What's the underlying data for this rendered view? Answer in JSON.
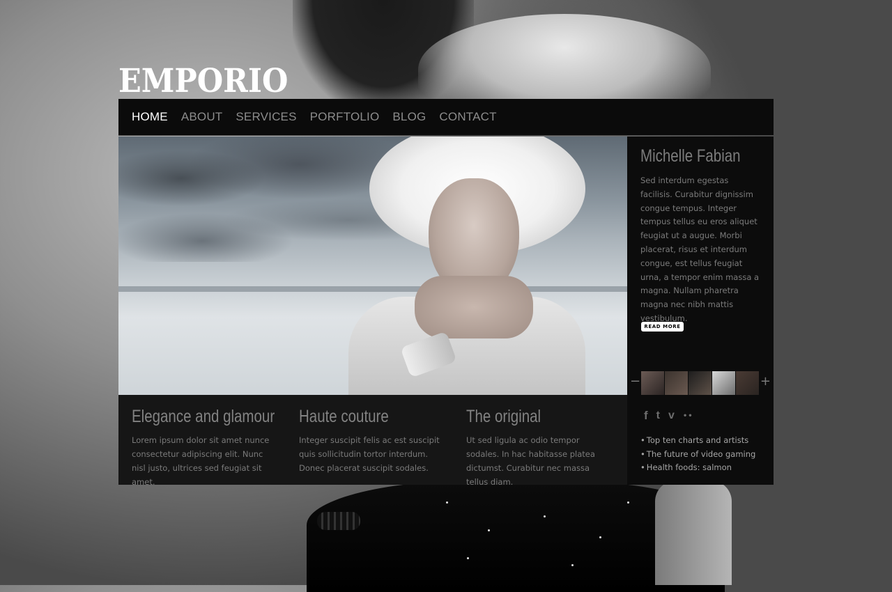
{
  "logo": "EMPORIO",
  "nav": {
    "items": [
      "HOME",
      "ABOUT",
      "SERVICES",
      "PORFTOLIO",
      "BLOG",
      "CONTACT"
    ],
    "active": "HOME"
  },
  "sidebar": {
    "title": "Michelle Fabian",
    "text": "Sed interdum egestas facilisis. Curabitur dignissim congue tempus. Integer tempus tellus eu eros aliquet feugiat ut a augue. Morbi placerat, risus et interdum congue, est tellus feugiat urna, a tempor enim massa a magna. Nullam pharetra magna nec nibh mattis vestibulum.",
    "read_more": "READ MORE",
    "thumb_prev": "−",
    "thumb_next": "+",
    "social": {
      "facebook": "f",
      "twitter": "t",
      "vimeo": "v",
      "flickr": "••"
    },
    "news": [
      "Top ten charts and artists",
      "The future of video gaming",
      "Health foods: salmon"
    ]
  },
  "features": [
    {
      "title": "Elegance and glamour",
      "text": "Lorem ipsum dolor sit amet nunce consectetur adipiscing elit. Nunc nisl justo, ultrices sed feugiat sit amet."
    },
    {
      "title": "Haute couture",
      "text": "Integer suscipit felis ac est suscipit quis sollicitudin tortor interdum. Donec placerat suscipit sodales."
    },
    {
      "title": "The original",
      "text": "Ut sed ligula ac odio tempor sodales. In hac habitasse platea dictumst. Curabitur nec massa tellus diam."
    }
  ]
}
